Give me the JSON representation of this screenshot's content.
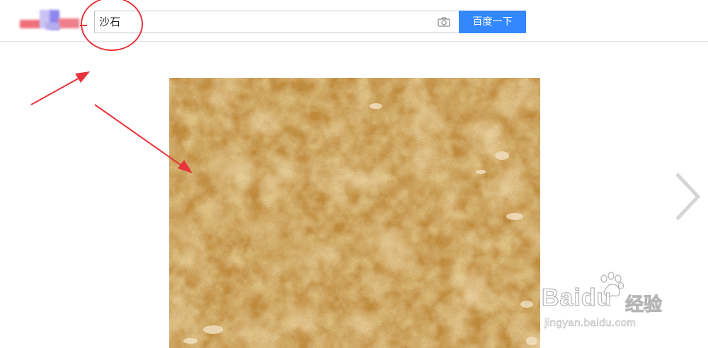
{
  "search": {
    "query": "沙石",
    "button_label": "百度一下"
  },
  "icons": {
    "camera": "camera-icon",
    "next": "chevron-right-icon"
  },
  "watermark": {
    "brand": "Baidu",
    "product": "经验",
    "url": "jingyan.baidu.com"
  },
  "colors": {
    "search_button": "#3388ff",
    "annotation_red": "#e8333a",
    "sand": "#c8953f"
  }
}
